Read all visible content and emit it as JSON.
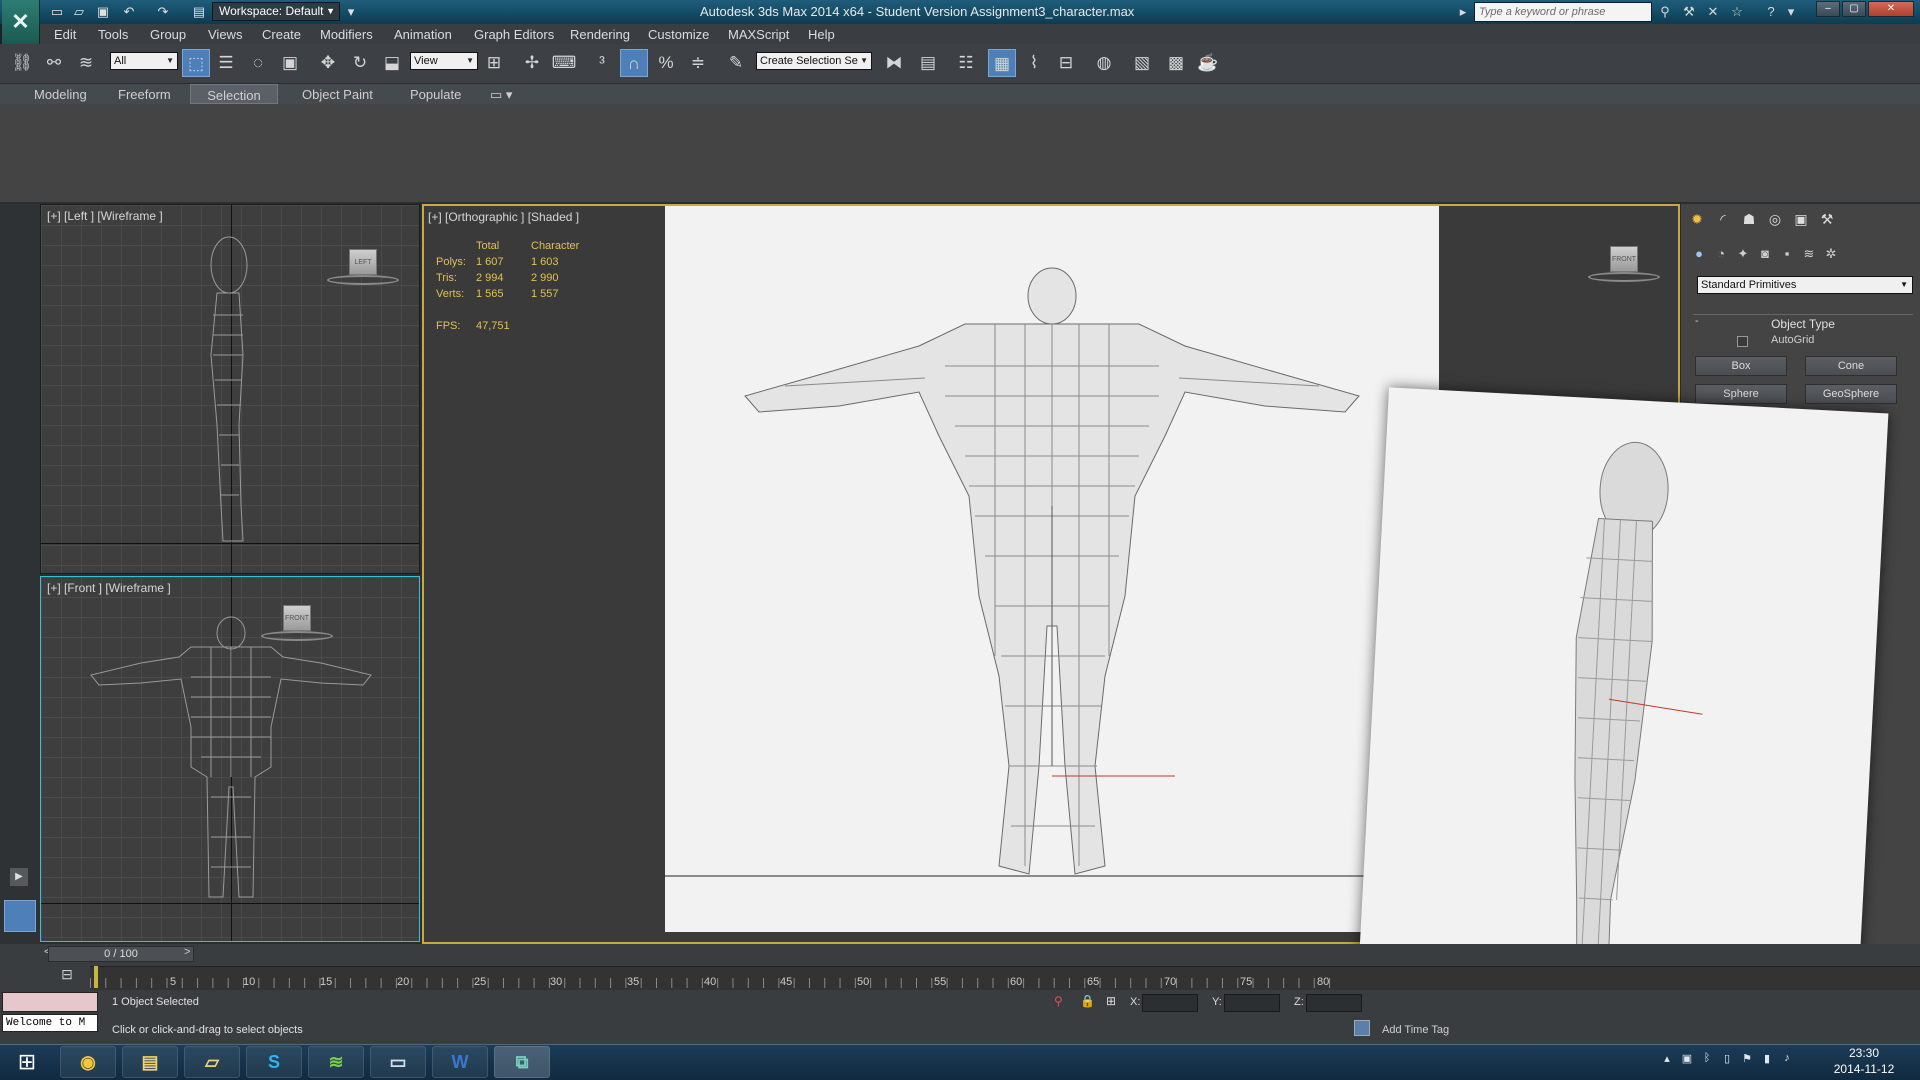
{
  "app": {
    "title": "Autodesk 3ds Max 2014 x64 - Student Version   Assignment3_character.max",
    "workspace": "Workspace: Default",
    "search_placeholder": "Type a keyword or phrase"
  },
  "menu": [
    "Edit",
    "Tools",
    "Group",
    "Views",
    "Create",
    "Modifiers",
    "Animation",
    "Graph Editors",
    "Rendering",
    "Customize",
    "MAXScript",
    "Help"
  ],
  "toolbar": {
    "filter_select": "All",
    "ref_coord_select": "View",
    "selection_set_placeholder": "Create Selection Se"
  },
  "ribbon_tabs": [
    "Modeling",
    "Freeform",
    "Selection",
    "Object Paint",
    "Populate"
  ],
  "viewports": {
    "left_label": "[+] [Left ] [Wireframe ]",
    "front_label": "[+] [Front ] [Wireframe ]",
    "persp_label": "[+] [Orthographic ] [Shaded ]",
    "left_cube": "LEFT",
    "front_cube": "FRONT",
    "persp_cube": "FRONT"
  },
  "stats": {
    "headers": [
      "Total",
      "Character"
    ],
    "rows": [
      {
        "label": "Polys:",
        "total": "1 607",
        "character": "1 603"
      },
      {
        "label": "Tris:",
        "total": "2 994",
        "character": "2 990"
      },
      {
        "label": "Verts:",
        "total": "1 565",
        "character": "1 557"
      }
    ],
    "fps_label": "FPS:",
    "fps_value": "47,751"
  },
  "command_panel": {
    "primitives_select": "Standard Primitives",
    "rollout_title": "Object Type",
    "autogrid_label": "AutoGrid",
    "buttons": [
      "Box",
      "Cone",
      "Sphere",
      "GeoSphere"
    ]
  },
  "timeline": {
    "slider_label": "0 / 100",
    "ticks": [
      "5",
      "10",
      "15",
      "20",
      "25",
      "30",
      "35",
      "40",
      "45",
      "50",
      "55",
      "60",
      "65",
      "70",
      "75",
      "80"
    ]
  },
  "status": {
    "welcome": "Welcome to M",
    "selection": "1 Object Selected",
    "prompt": "Click or click-and-drag to select objects",
    "x_label": "X:",
    "y_label": "Y:",
    "z_label": "Z:",
    "add_time_tag": "Add Time Tag"
  },
  "taskbar": {
    "time": "23:30",
    "date": "2014-11-12"
  },
  "colors": {
    "active_viewport_border": "#c7a844",
    "stats_text": "#e3c14a",
    "selection_tool_active": "#4e7fb8"
  }
}
